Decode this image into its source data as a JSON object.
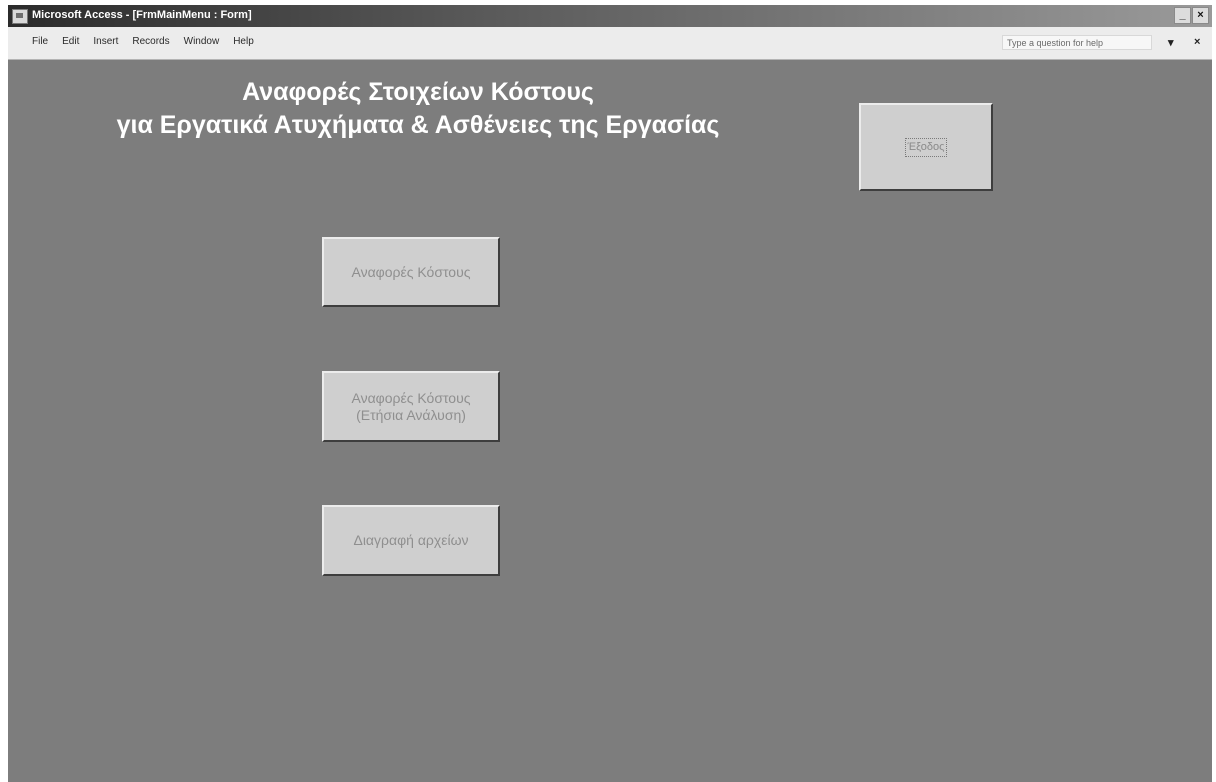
{
  "window": {
    "title": "Microsoft Access - [FrmMainMenu : Form]",
    "controls": [
      "_",
      "×"
    ]
  },
  "menubar": {
    "items": [
      "File",
      "Edit",
      "Insert",
      "Records",
      "Window",
      "Help"
    ],
    "help_placeholder": "Type a question for help",
    "doc_controls": [
      "▾",
      "×"
    ]
  },
  "form": {
    "heading_line1": "Αναφορές Στοιχείων Κόστους",
    "heading_line2": "για Εργατικά Ατυχήματα & Ασθένειες της Εργασίας",
    "exit_label": "Έξοδος",
    "cost_reports_label": "Αναφορές Κόστους",
    "annual_reports_line1": "Αναφορές Κόστους",
    "annual_reports_line2": "(Ετήσια Ανάλυση)",
    "delete_files_label": "Διαγραφή αρχείων"
  }
}
